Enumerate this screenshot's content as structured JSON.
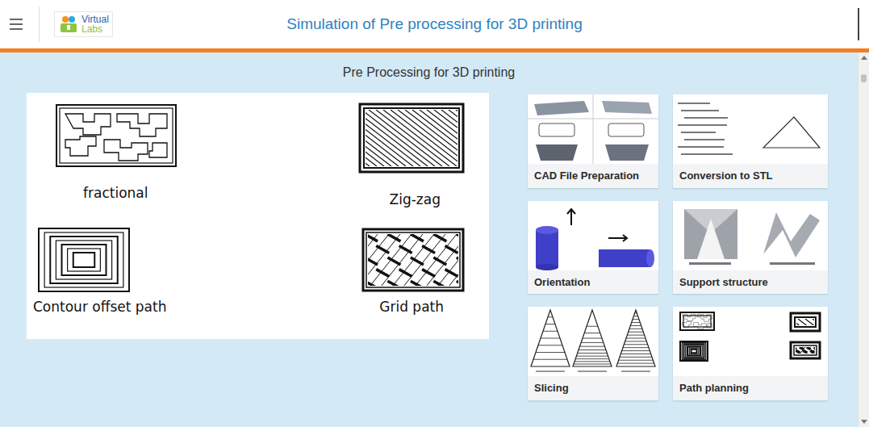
{
  "header": {
    "title": "Simulation of Pre processing for 3D printing",
    "logo": [
      "Virtual",
      "Labs"
    ]
  },
  "page_heading": "Pre Processing for 3D printing",
  "diagram": {
    "items": [
      {
        "label": "fractional",
        "kind": "fractional"
      },
      {
        "label": "Zig-zag",
        "kind": "zigzag"
      },
      {
        "label": "Contour offset path",
        "kind": "contour"
      },
      {
        "label": "Grid path",
        "kind": "grid"
      }
    ]
  },
  "cards": [
    {
      "label": "CAD File Preparation",
      "kind": "cad"
    },
    {
      "label": "Conversion to STL",
      "kind": "stl"
    },
    {
      "label": "Orientation",
      "kind": "orientation"
    },
    {
      "label": "Support structure",
      "kind": "support"
    },
    {
      "label": "Slicing",
      "kind": "slicing"
    },
    {
      "label": "Path planning",
      "kind": "paths"
    }
  ],
  "scrollbar": {
    "level": 0.88
  }
}
